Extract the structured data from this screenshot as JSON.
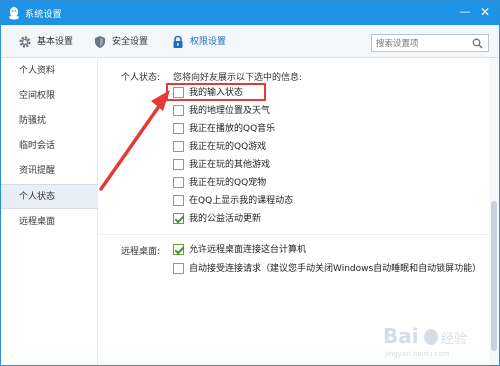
{
  "window": {
    "title": "系统设置",
    "minimize_glyph": "—",
    "close_glyph": "✕"
  },
  "toolbar": {
    "basic_label": "基本设置",
    "security_label": "安全设置",
    "permission_label": "权限设置"
  },
  "search": {
    "placeholder": "搜索设置项"
  },
  "sidebar": {
    "items": [
      {
        "label": "个人资料"
      },
      {
        "label": "空间权限"
      },
      {
        "label": "防骚扰"
      },
      {
        "label": "临时会话"
      },
      {
        "label": "资讯提醒"
      },
      {
        "label": "个人状态"
      },
      {
        "label": "远程桌面"
      }
    ],
    "active_index": 5
  },
  "personal_status": {
    "section_label": "个人状态:",
    "description": "您将向好友展示以下选中的信息:",
    "options": [
      {
        "label": "我的输入状态",
        "checked": false
      },
      {
        "label": "我的地理位置及天气",
        "checked": false
      },
      {
        "label": "我正在播放的QQ音乐",
        "checked": false
      },
      {
        "label": "我正在玩的QQ游戏",
        "checked": false
      },
      {
        "label": "我正在玩的其他游戏",
        "checked": false
      },
      {
        "label": "我正在玩的QQ宠物",
        "checked": false
      },
      {
        "label": "在QQ上显示我的课程动态",
        "checked": false
      },
      {
        "label": "我的公益活动更新",
        "checked": true
      }
    ]
  },
  "remote_desktop": {
    "section_label": "远程桌面:",
    "options": [
      {
        "label": "允许远程桌面连接这台计算机",
        "checked": true
      },
      {
        "label": "自动接受连接请求（建议您手动关闭Windows自动睡眠和自动锁屏功能）",
        "checked": false
      }
    ]
  },
  "colors": {
    "titlebar": "#1e93e6",
    "accent": "#1a6fc6",
    "highlight": "#e53935",
    "check": "#3a9a2a"
  }
}
